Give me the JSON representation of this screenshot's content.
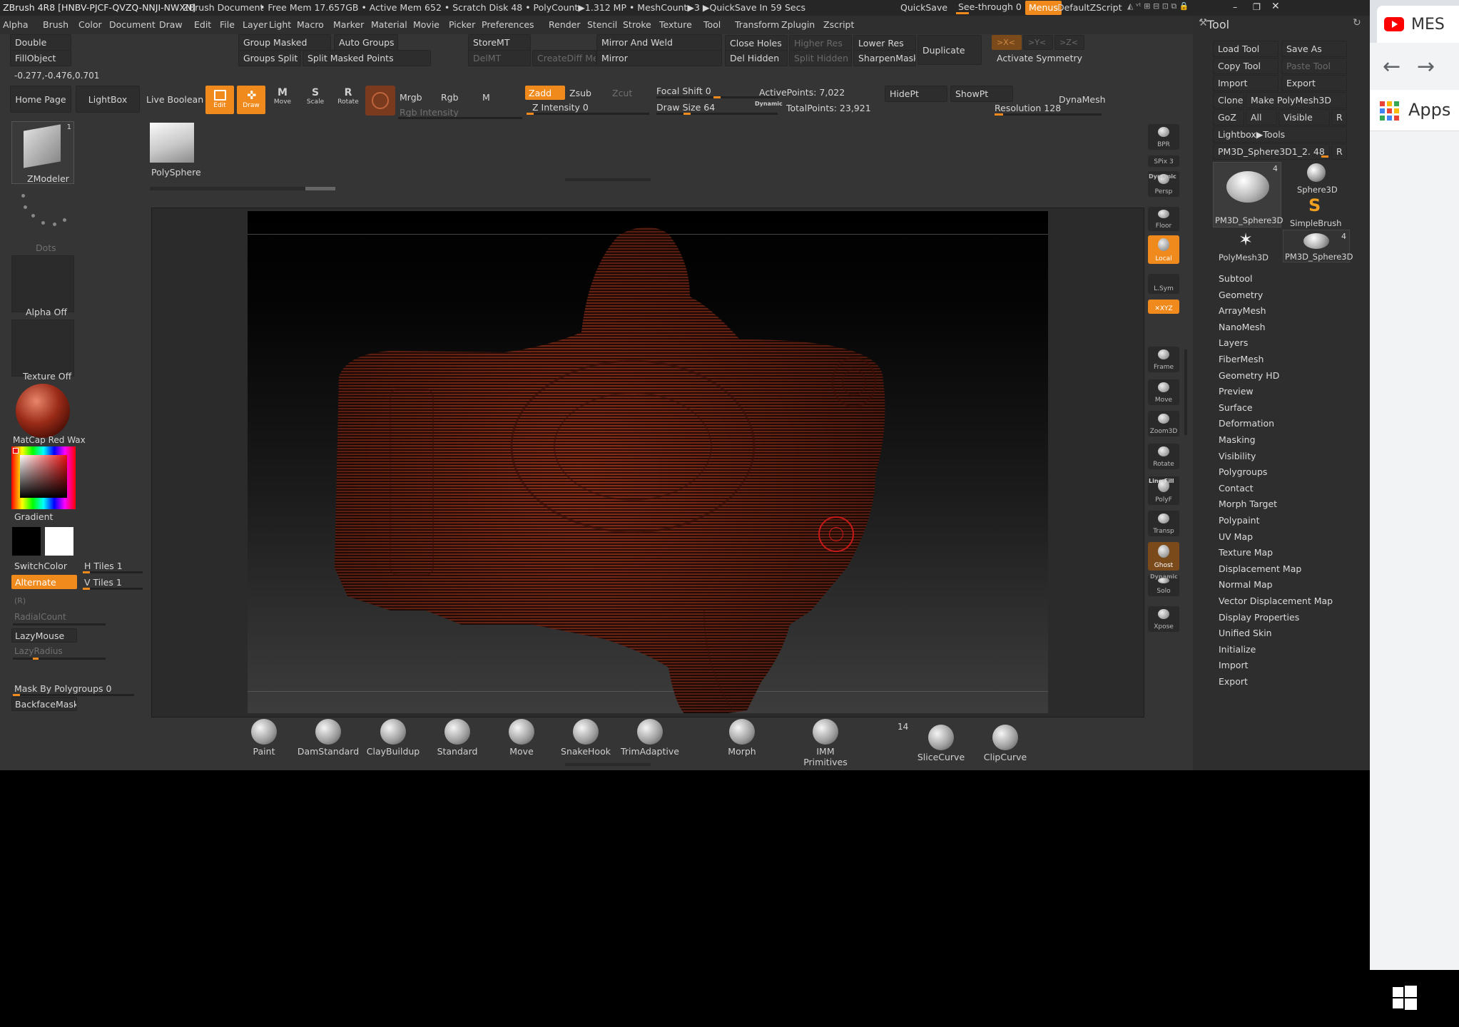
{
  "titlebar": {
    "app": "ZBrush 4R8 [HNBV-PJCF-QVZQ-NNJI-NWXN]",
    "doc": "ZBrush Document",
    "stats": "• Free Mem 17.657GB • Active Mem 652 • Scratch Disk 48 • PolyCount▶1.312 MP • MeshCount▶3 ▶QuickSave In 59 Secs",
    "quicksave": "QuickSave",
    "see_through": "See-through  0",
    "menus": "Menus",
    "default_zscript": "DefaultZScript"
  },
  "menu": [
    "Alpha",
    "Brush",
    "Color",
    "Document",
    "Draw",
    "Edit",
    "File",
    "Layer",
    "Light",
    "Macro",
    "Marker",
    "Material",
    "Movie",
    "Picker",
    "Preferences",
    "Render",
    "Stencil",
    "Stroke",
    "Texture",
    "Tool",
    "Transform",
    "Zplugin",
    "Zscript"
  ],
  "topshelf": {
    "double": "Double",
    "fillobject": "FillObject",
    "coords": "-0.277,-0.476,0.701",
    "group_masked": "Group Masked",
    "auto_groups": "Auto Groups",
    "groups_split": "Groups Split",
    "split_masked_points": "Split Masked Points",
    "storemt": "StoreMT",
    "delmt": "DelMT",
    "createdifmesh": "CreateDiff Mesh",
    "mirror_and_weld": "Mirror And Weld",
    "mirror": "Mirror",
    "close_holes": "Close Holes",
    "higher_res": "Higher Res",
    "lower_res": "Lower Res",
    "del_hidden": "Del Hidden",
    "split_hidden": "Split Hidden",
    "sharpen_mask": "SharpenMask",
    "duplicate": "Duplicate",
    "activate_symmetry": "Activate Symmetry",
    "xsym": ">X<",
    "ysym": ">Y<",
    "zsym": ">Z<"
  },
  "toolbar": {
    "home_page": "Home Page",
    "lightbox": "LightBox",
    "live_boolean": "Live Boolean",
    "edit": "Edit",
    "draw": "Draw",
    "move": "Move",
    "scale": "Scale",
    "rotate": "Rotate",
    "mrgb": "Mrgb",
    "rgb": "Rgb",
    "m": "M",
    "rgb_intensity": "Rgb Intensity",
    "zadd": "Zadd",
    "zsub": "Zsub",
    "zcut": "Zcut",
    "z_intensity": "Z Intensity 0",
    "focal_shift": "Focal Shift 0",
    "draw_size": "Draw Size 64",
    "dynamic": "Dynamic",
    "active_points": "ActivePoints: 7,022",
    "total_points": "TotalPoints: 23,921",
    "hidept": "HidePt",
    "showpt": "ShowPt",
    "dynamesh": "DynaMesh",
    "resolution": "Resolution 128"
  },
  "left": {
    "tool_name": "ZModeler",
    "tool_count": "1",
    "stroke": "Dots",
    "alpha": "Alpha Off",
    "texture": "Texture Off",
    "material": "MatCap Red Wax",
    "gradient": "Gradient",
    "switchcolor": "SwitchColor",
    "alternate": "Alternate",
    "htiles": "H Tiles 1",
    "vtiles": "V Tiles 1",
    "r": "(R)",
    "radialcount": "RadialCount",
    "lazymouse": "LazyMouse",
    "lazyradius": "LazyRadius",
    "mask_by_polygroups": "Mask By Polygroups 0",
    "backface_mask": "BackfaceMask"
  },
  "doc_thumb": {
    "label": "PolySphere"
  },
  "shelf": [
    {
      "name": "bpr",
      "label": "BPR"
    },
    {
      "name": "spix",
      "label": "SPix 3"
    },
    {
      "name": "persp",
      "label": "Persp"
    },
    {
      "name": "floor",
      "label": "Floor"
    },
    {
      "name": "local",
      "label": "Local"
    },
    {
      "name": "lsym",
      "label": "L.Sym"
    },
    {
      "name": "xyz",
      "label": "✕XYZ"
    },
    {
      "name": "frame",
      "label": "Frame"
    },
    {
      "name": "move",
      "label": "Move"
    },
    {
      "name": "zoom3d",
      "label": "Zoom3D"
    },
    {
      "name": "rotate",
      "label": "Rotate"
    },
    {
      "name": "polyf",
      "label": "PolyF"
    },
    {
      "name": "transp",
      "label": "Transp"
    },
    {
      "name": "ghost",
      "label": "Ghost"
    },
    {
      "name": "solo",
      "label": "Solo"
    },
    {
      "name": "xpose",
      "label": "Xpose"
    }
  ],
  "shelf_extra": {
    "dynamic": "Dynamic",
    "line_fill": "Line Fill",
    "dynamic2": "Dynamic"
  },
  "tool_palette": {
    "title": "Tool",
    "load_tool": "Load Tool",
    "save_as": "Save As",
    "copy_tool": "Copy Tool",
    "paste_tool": "Paste Tool",
    "import": "Import",
    "export": "Export",
    "clone": "Clone",
    "make_polymesh": "Make PolyMesh3D",
    "goz": "GoZ",
    "all": "All",
    "visible": "Visible",
    "r": "R",
    "lightbox_tools": "Lightbox▶Tools",
    "current_tool": "PM3D_Sphere3D1_2. 48",
    "thumbs": [
      {
        "name": "PM3D_Sphere3D",
        "count": "4"
      },
      {
        "name": "Sphere3D",
        "count": ""
      },
      {
        "name": "SimpleBrush",
        "count": ""
      },
      {
        "name": "PolyMesh3D",
        "count": ""
      },
      {
        "name": "PM3D_Sphere3D",
        "count": "4"
      }
    ],
    "subpalettes": [
      "Subtool",
      "Geometry",
      "ArrayMesh",
      "NanoMesh",
      "Layers",
      "FiberMesh",
      "Geometry HD",
      "Preview",
      "Surface",
      "Deformation",
      "Masking",
      "Visibility",
      "Polygroups",
      "Contact",
      "Morph Target",
      "Polypaint",
      "UV Map",
      "Texture Map",
      "Displacement Map",
      "Normal Map",
      "Vector Displacement Map",
      "Display Properties",
      "Unified Skin",
      "Initialize",
      "Import",
      "Export"
    ]
  },
  "brushes": [
    {
      "label": "Paint"
    },
    {
      "label": "DamStandard"
    },
    {
      "label": "ClayBuildup"
    },
    {
      "label": "Standard"
    },
    {
      "label": "Move"
    },
    {
      "label": "SnakeHook"
    },
    {
      "label": "TrimAdaptive"
    },
    {
      "label": "Morph"
    },
    {
      "label": "IMM Primitives"
    },
    {
      "label": "SliceCurve"
    },
    {
      "label": "ClipCurve"
    }
  ],
  "imm_count": "14",
  "chrome": {
    "tab_title": "MES",
    "apps": "Apps"
  },
  "colors": {
    "accent": "#f08a1c",
    "panel": "#353535",
    "youtube": "#ff0000"
  }
}
